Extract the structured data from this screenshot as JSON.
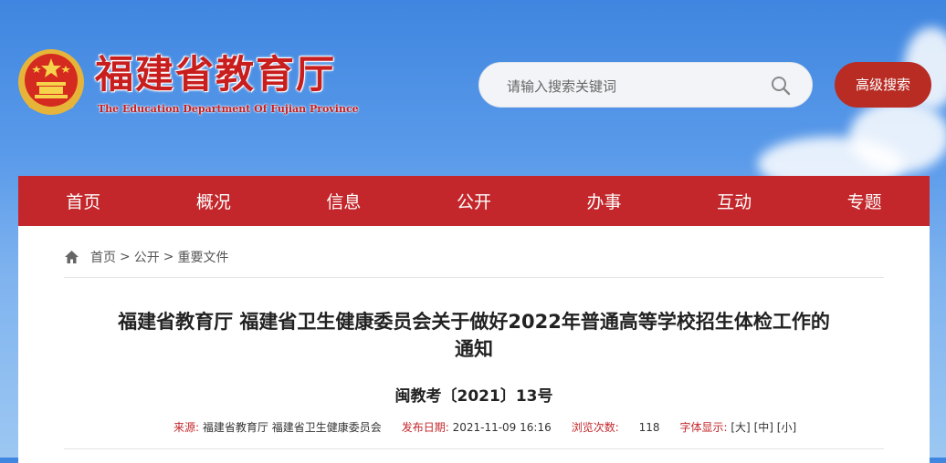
{
  "site": {
    "name_cn": "福建省教育厅",
    "name_en": "The Education Department Of Fujian Province"
  },
  "search": {
    "placeholder": "请输入搜索关键词",
    "advanced_label": "高级搜索"
  },
  "nav": {
    "items": [
      {
        "label": "首页"
      },
      {
        "label": "概况"
      },
      {
        "label": "信息"
      },
      {
        "label": "公开"
      },
      {
        "label": "办事"
      },
      {
        "label": "互动"
      },
      {
        "label": "专题"
      }
    ]
  },
  "breadcrumb": {
    "items": [
      "首页",
      "公开",
      "重要文件"
    ],
    "separator": ">"
  },
  "article": {
    "title_line1": "福建省教育厅 福建省卫生健康委员会关于做好2022年普通高等学校招生体检工作的",
    "title_line2": "通知",
    "doc_number": "闽教考〔2021〕13号",
    "source_label": "来源:",
    "source": "福建省教育厅 福建省卫生健康委员会",
    "date_label": "发布日期:",
    "date": "2021-11-09 16:16",
    "views_label": "浏览次数:",
    "views": "118",
    "font_label": "字体显示:",
    "font_sizes": [
      "[大]",
      "[中]",
      "[小]"
    ]
  },
  "colors": {
    "brand_red": "#c3272b",
    "sky_blue": "#4a8fe4"
  }
}
